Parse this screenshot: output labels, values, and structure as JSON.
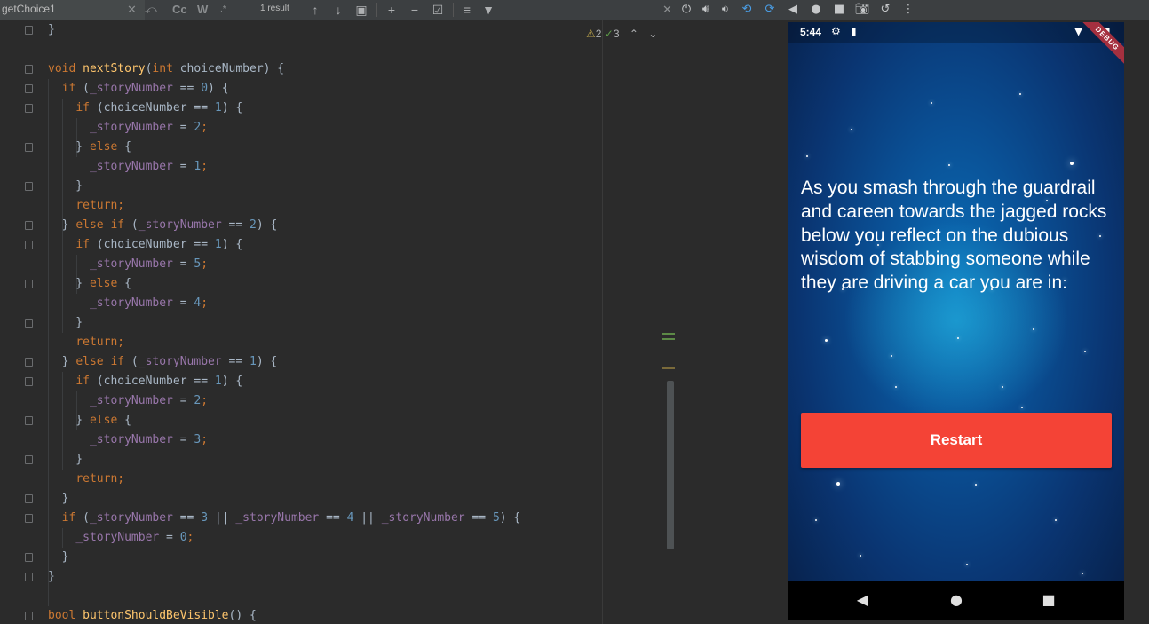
{
  "find": {
    "query": "getChoice1",
    "result_count": "1 result",
    "option_match_case": "Cc",
    "option_words": "W",
    "option_regex": ".*"
  },
  "editor": {
    "inspections": {
      "warnings": "2",
      "ok": "3"
    },
    "lines": [
      [
        {
          "t": "}"
        }
      ],
      [],
      [
        {
          "t": "void",
          "c": "kw"
        },
        {
          "t": " "
        },
        {
          "t": "nextStory",
          "c": "fn"
        },
        {
          "t": "("
        },
        {
          "t": "int",
          "c": "kw"
        },
        {
          "t": " choiceNumber) {"
        }
      ],
      [
        {
          "t": "  "
        },
        {
          "t": "if",
          "c": "kw"
        },
        {
          "t": " ("
        },
        {
          "t": "_storyNumber",
          "c": "fld"
        },
        {
          "t": " == "
        },
        {
          "t": "0",
          "c": "num"
        },
        {
          "t": ") {"
        }
      ],
      [
        {
          "t": "    "
        },
        {
          "t": "if",
          "c": "kw"
        },
        {
          "t": " (choiceNumber == "
        },
        {
          "t": "1",
          "c": "num"
        },
        {
          "t": ") {"
        }
      ],
      [
        {
          "t": "      "
        },
        {
          "t": "_storyNumber",
          "c": "fld"
        },
        {
          "t": " = "
        },
        {
          "t": "2",
          "c": "num"
        },
        {
          "t": ";",
          "c": "kw"
        }
      ],
      [
        {
          "t": "    } "
        },
        {
          "t": "else",
          "c": "kw"
        },
        {
          "t": " {"
        }
      ],
      [
        {
          "t": "      "
        },
        {
          "t": "_storyNumber",
          "c": "fld"
        },
        {
          "t": " = "
        },
        {
          "t": "1",
          "c": "num"
        },
        {
          "t": ";",
          "c": "kw"
        }
      ],
      [
        {
          "t": "    }"
        }
      ],
      [
        {
          "t": "    "
        },
        {
          "t": "return;",
          "c": "kw"
        }
      ],
      [
        {
          "t": "  } "
        },
        {
          "t": "else if",
          "c": "kw"
        },
        {
          "t": " ("
        },
        {
          "t": "_storyNumber",
          "c": "fld"
        },
        {
          "t": " == "
        },
        {
          "t": "2",
          "c": "num"
        },
        {
          "t": ") {"
        }
      ],
      [
        {
          "t": "    "
        },
        {
          "t": "if",
          "c": "kw"
        },
        {
          "t": " (choiceNumber == "
        },
        {
          "t": "1",
          "c": "num"
        },
        {
          "t": ") {"
        }
      ],
      [
        {
          "t": "      "
        },
        {
          "t": "_storyNumber",
          "c": "fld"
        },
        {
          "t": " = "
        },
        {
          "t": "5",
          "c": "num"
        },
        {
          "t": ";",
          "c": "kw"
        }
      ],
      [
        {
          "t": "    } "
        },
        {
          "t": "else",
          "c": "kw"
        },
        {
          "t": " {"
        }
      ],
      [
        {
          "t": "      "
        },
        {
          "t": "_storyNumber",
          "c": "fld"
        },
        {
          "t": " = "
        },
        {
          "t": "4",
          "c": "num"
        },
        {
          "t": ";",
          "c": "kw"
        }
      ],
      [
        {
          "t": "    }"
        }
      ],
      [
        {
          "t": "    "
        },
        {
          "t": "return;",
          "c": "kw"
        }
      ],
      [
        {
          "t": "  } "
        },
        {
          "t": "else if",
          "c": "kw"
        },
        {
          "t": " ("
        },
        {
          "t": "_storyNumber",
          "c": "fld"
        },
        {
          "t": " == "
        },
        {
          "t": "1",
          "c": "num"
        },
        {
          "t": ") {"
        }
      ],
      [
        {
          "t": "    "
        },
        {
          "t": "if",
          "c": "kw"
        },
        {
          "t": " (choiceNumber == "
        },
        {
          "t": "1",
          "c": "num"
        },
        {
          "t": ") {"
        }
      ],
      [
        {
          "t": "      "
        },
        {
          "t": "_storyNumber",
          "c": "fld"
        },
        {
          "t": " = "
        },
        {
          "t": "2",
          "c": "num"
        },
        {
          "t": ";",
          "c": "kw"
        }
      ],
      [
        {
          "t": "    } "
        },
        {
          "t": "else",
          "c": "kw"
        },
        {
          "t": " {"
        }
      ],
      [
        {
          "t": "      "
        },
        {
          "t": "_storyNumber",
          "c": "fld"
        },
        {
          "t": " = "
        },
        {
          "t": "3",
          "c": "num"
        },
        {
          "t": ";",
          "c": "kw"
        }
      ],
      [
        {
          "t": "    }"
        }
      ],
      [
        {
          "t": "    "
        },
        {
          "t": "return;",
          "c": "kw"
        }
      ],
      [
        {
          "t": "  }"
        }
      ],
      [
        {
          "t": "  "
        },
        {
          "t": "if",
          "c": "kw"
        },
        {
          "t": " ("
        },
        {
          "t": "_storyNumber",
          "c": "fld"
        },
        {
          "t": " == "
        },
        {
          "t": "3",
          "c": "num"
        },
        {
          "t": " || "
        },
        {
          "t": "_storyNumber",
          "c": "fld"
        },
        {
          "t": " == "
        },
        {
          "t": "4",
          "c": "num"
        },
        {
          "t": " || "
        },
        {
          "t": "_storyNumber",
          "c": "fld"
        },
        {
          "t": " == "
        },
        {
          "t": "5",
          "c": "num"
        },
        {
          "t": ") {"
        }
      ],
      [
        {
          "t": "    "
        },
        {
          "t": "_storyNumber",
          "c": "fld"
        },
        {
          "t": " = "
        },
        {
          "t": "0",
          "c": "num"
        },
        {
          "t": ";",
          "c": "kw"
        }
      ],
      [
        {
          "t": "  }"
        }
      ],
      [
        {
          "t": "}"
        }
      ],
      [],
      [
        {
          "t": "bool",
          "c": "kw"
        },
        {
          "t": " "
        },
        {
          "t": "buttonShouldBeVisible",
          "c": "fn"
        },
        {
          "t": "() {"
        }
      ]
    ]
  },
  "phone": {
    "status_time": "5:44",
    "debug_banner": "DEBUG",
    "story_text": "As you smash through the guardrail and careen towards the jagged rocks below you reflect on the dubious wisdom of stabbing someone while they are driving a car you are in.",
    "restart_label": "Restart"
  },
  "icons": {
    "findbar": [
      "clear-icon",
      "replace-toggle-icon",
      "prev-occurrence-icon",
      "next-occurrence-icon",
      "open-in-window-icon",
      "add-selection-icon",
      "remove-selection-icon",
      "select-all-icon",
      "filter-icon"
    ],
    "emulator": [
      "power-icon",
      "volume-up-icon",
      "volume-down-icon",
      "rotate-left-icon",
      "rotate-right-icon",
      "back-icon",
      "home-icon",
      "overview-icon",
      "screenshot-icon",
      "rewind-icon",
      "more-icon"
    ]
  }
}
